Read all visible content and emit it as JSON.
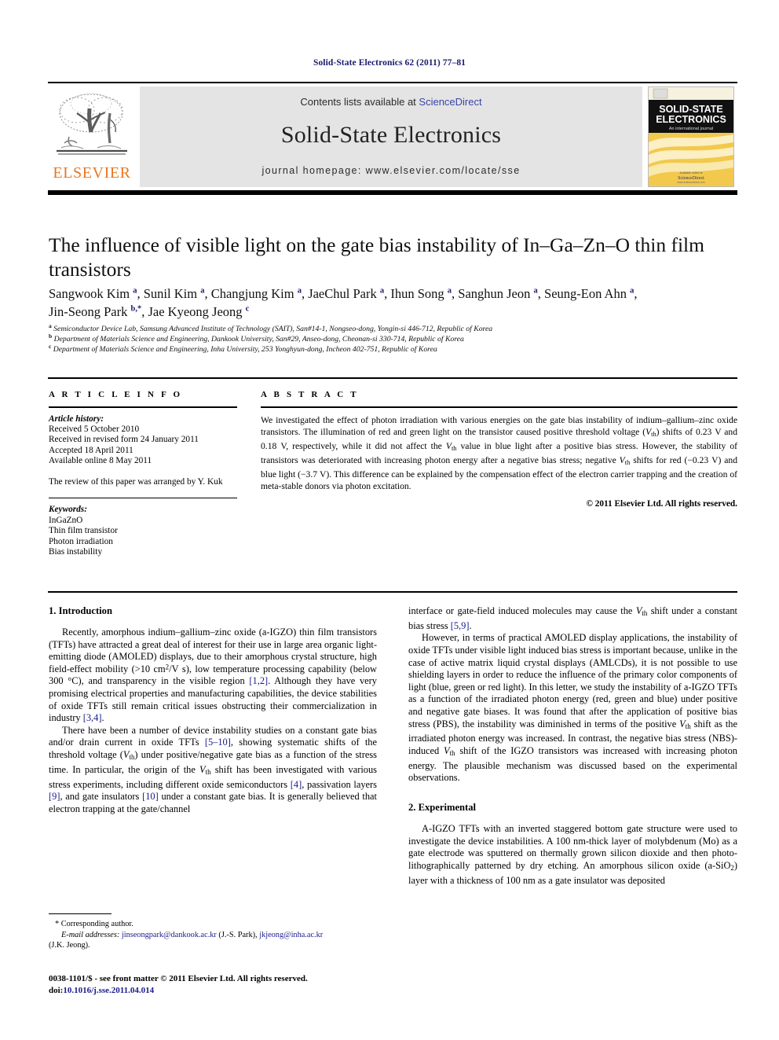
{
  "running_head": "Solid-State Electronics 62 (2011) 77–81",
  "masthead": {
    "contents_prefix": "Contents lists available at ",
    "sciencedirect": "ScienceDirect",
    "journal_title": "Solid-State Electronics",
    "homepage": "journal homepage: www.elsevier.com/locate/sse",
    "publisher_wordmark": "ELSEVIER",
    "cover": {
      "line1": "SOLID-STATE",
      "line2": "ELECTRONICS",
      "subtitle": "An international journal",
      "footer1": "Available online at",
      "footer2": "ScienceDirect",
      "footer3": "www.sciencedirect.com"
    },
    "accent_orange": "#E87722",
    "link_blue": "#3a44a8",
    "band_grey": "#e4e4e4"
  },
  "article": {
    "title": "The influence of visible light on the gate bias instability of In–Ga–Zn–O thin film transistors",
    "authors_line1": "Sangwook Kim ª, Sunil Kim ª, Changjung Kim ª, JaeChul Park ª, Ihun Song ª, Sanghun Jeon ª, Seung-Eon Ahn ª,",
    "authors_line2": "Jin-Seong Park ᵇ,*, Jae Kyeong Jeong ᶜ",
    "affiliations": [
      "Semiconductor Device Lab, Samsung Advanced Institute of Technology (SAIT), San#14-1, Nongseo-dong, Yongin-si 446-712, Republic of Korea",
      "Department of Materials Science and Engineering, Dankook University, San#29, Anseo-dong, Cheonan-si 330-714, Republic of Korea",
      "Department of Materials Science and Engineering, Inha University, 253 Yonghyun-dong, Incheon 402-751, Republic of Korea"
    ],
    "affiliation_marks": [
      "a",
      "b",
      "c"
    ]
  },
  "article_info": {
    "heading": "A R T I C L E   I N F O",
    "history_label": "Article history:",
    "history": [
      "Received 5 October 2010",
      "Received in revised form 24 January 2011",
      "Accepted 18 April 2011",
      "Available online 8 May 2011"
    ],
    "review_note": "The review of this paper was arranged by Y. Kuk",
    "keywords_label": "Keywords:",
    "keywords": [
      "InGaZnO",
      "Thin film transistor",
      "Photon irradiation",
      "Bias instability"
    ]
  },
  "abstract": {
    "heading": "A B S T R A C T",
    "copyright": "© 2011 Elsevier Ltd. All rights reserved."
  },
  "sections": {
    "introduction_heading": "1. Introduction",
    "experimental_heading": "2. Experimental"
  },
  "footnote": {
    "corresponding": "* Corresponding author.",
    "email_label": "E-mail addresses:",
    "email1": "jinseongpark@dankook.ac.kr",
    "email1_person": "(J.-S. Park),",
    "email2": "jkjeong@inha.ac.kr",
    "email2_person": "(J.K. Jeong)."
  },
  "imprint": {
    "issn_line": "0038-1101/$ - see front matter © 2011 Elsevier Ltd. All rights reserved.",
    "doi_label": "doi:",
    "doi_value": "10.1016/j.sse.2011.04.014"
  }
}
